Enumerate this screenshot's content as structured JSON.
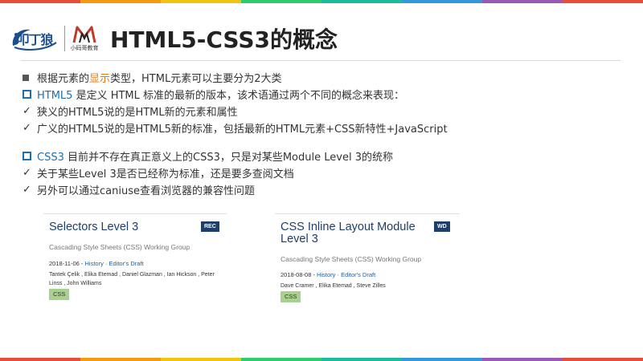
{
  "colors": {
    "rainbow": [
      "#e74c3c",
      "#f39c12",
      "#f1c40f",
      "#2ecc71",
      "#1abc9c",
      "#3498db",
      "#9b59b6",
      "#e74c3c"
    ],
    "accent_orange": "#e07b1a",
    "accent_blue": "#1a6fb5",
    "card_title": "#1f3e69",
    "tag_green": "#a9d18e"
  },
  "header": {
    "logo1_text": "叩丁狼",
    "logo2_caption": "小码哥教育",
    "title": "HTML5-CSS3的概念"
  },
  "lines": {
    "l1": {
      "pre": "根据元素的",
      "highlight": "显示",
      "post": "类型，HTML元素可以主要分为2大类"
    },
    "l2": {
      "highlight": "HTML5",
      "post": " 是定义 HTML 标准的最新的版本，该术语通过两个不同的概念来表现："
    },
    "l3": {
      "text": "狭义的HTML5说的是HTML新的元素和属性"
    },
    "l4": {
      "text": "广义的HTML5说的是HTML5新的标准，包括最新的HTML元素+CSS新特性+JavaScript"
    },
    "l5": {
      "highlight": "CSS3",
      "post": " 目前并不存在真正意义上的CSS3，只是对某些Module Level 3的统称"
    },
    "l6": {
      "text": "关于某些Level 3是否已经称为标准，还是要多查阅文档"
    },
    "l7": {
      "text": "另外可以通过caniuse查看浏览器的兼容性问题"
    }
  },
  "cards": [
    {
      "title": "Selectors Level 3",
      "badge": "REC",
      "subtitle": "Cascading Style Sheets (CSS) Working Group",
      "date": "2018-11-06",
      "sep": " - ",
      "history": "History",
      "dot": " · ",
      "draft": "Editor's Draft",
      "authors": "Tantek Çelik , Elika Etemad , Daniel Glazman , Ian Hickson , Peter Linss , John Williams",
      "tag": "CSS"
    },
    {
      "title": "CSS Inline Layout Module Level 3",
      "badge": "WD",
      "subtitle": "Cascading Style Sheets (CSS) Working Group",
      "date": "2018-08-08",
      "sep": " - ",
      "history": "History",
      "dot": " · ",
      "draft": "Editor's Draft",
      "authors": "Dave Cramer , Elika Etemad , Steve Zilles",
      "tag": "CSS"
    }
  ]
}
